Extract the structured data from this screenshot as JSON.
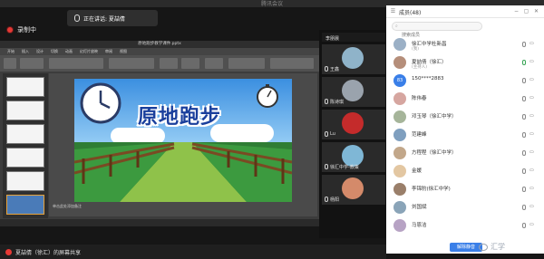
{
  "window": {
    "title": "腾讯会议"
  },
  "recording": {
    "label": "录制中"
  },
  "ppt": {
    "file_title": "原地跑步教学课件.pptx",
    "tabs": [
      "开始",
      "插入",
      "设计",
      "切换",
      "动画",
      "幻灯片放映",
      "审阅",
      "视图"
    ],
    "note": "单击此处添加备注",
    "slide_title": "原地跑步"
  },
  "tiles": [
    {
      "name": "李朋晨"
    },
    {
      "name": "王鑫"
    },
    {
      "name": "陈诗琪"
    },
    {
      "name": "Lu"
    },
    {
      "name": "徐汇中学-教策"
    },
    {
      "name": "杨阳"
    }
  ],
  "members_panel": {
    "title": "成员(48)",
    "search_placeholder": "搜索成员",
    "speaking_label": "正在讲话: 夏喆倩",
    "members": [
      {
        "name": "徐汇中学杜新昌",
        "sub": "(我)"
      },
      {
        "name": "夏喆倩（徐汇）",
        "sub": "(主持人)"
      },
      {
        "name": "150****2883",
        "sub": "",
        "avatar_text": "83"
      },
      {
        "name": "陈伟春",
        "sub": ""
      },
      {
        "name": "邓玉琴（徐汇中学）",
        "sub": ""
      },
      {
        "name": "范建峰",
        "sub": ""
      },
      {
        "name": "方程程（徐汇中学）",
        "sub": ""
      },
      {
        "name": "金媛",
        "sub": ""
      },
      {
        "name": "李锦豹(徐汇中学)",
        "sub": ""
      },
      {
        "name": "刘国斌",
        "sub": ""
      },
      {
        "name": "马恩洁",
        "sub": ""
      }
    ],
    "mute_all_label": "解除静音"
  },
  "bottom": {
    "share_label": "夏喆倩（徐汇）的屏幕共享"
  },
  "watermark": {
    "text": "汇学"
  },
  "colors": {
    "accent": "#3a7fe8",
    "record": "#e53935",
    "slide_title": "#1a3f9c"
  }
}
